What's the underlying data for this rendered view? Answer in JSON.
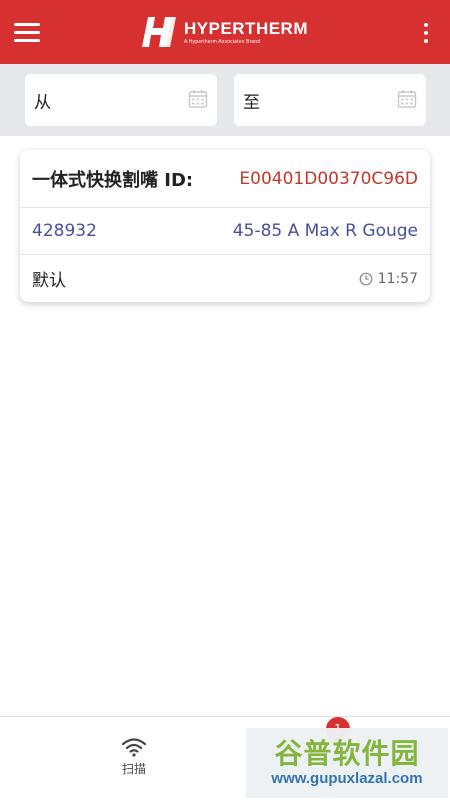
{
  "header": {
    "brand_name": "HYPERTHERM",
    "brand_tagline": "A Hypertherm Associates Brand"
  },
  "filters": {
    "from_placeholder": "从",
    "to_placeholder": "至"
  },
  "card": {
    "title": "一体式快换割嘴 ID:",
    "id_value": "E00401D00370C96D",
    "part_number": "428932",
    "part_description": "45-85 A Max R Gouge",
    "mode": "默认",
    "time": "11:57"
  },
  "bottom_nav": {
    "scan_label": "扫描",
    "badge_count": "1"
  },
  "watermark": {
    "line1": "谷普软件园",
    "line2": "www.gupuxlazal.com"
  },
  "colors": {
    "brand_red": "#d63031",
    "id_red": "#c0392b",
    "part_blue": "#4b4ea0",
    "filter_bg": "#e6e8eb"
  },
  "icons": [
    "menu-icon",
    "more-icon",
    "calendar-icon",
    "clock-icon",
    "wifi-icon"
  ]
}
